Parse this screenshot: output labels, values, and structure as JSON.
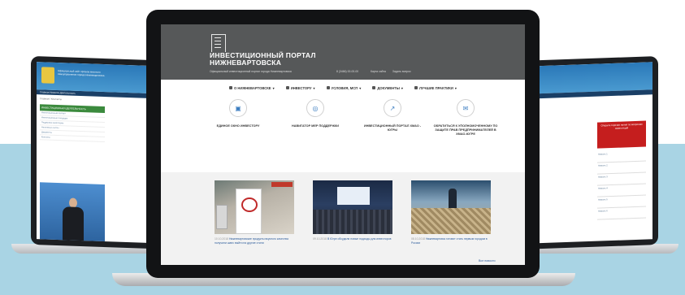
{
  "portal": {
    "title_line1": "ИНВЕСТИЦИОННЫЙ ПОРТАЛ",
    "title_line2": "НИЖНЕВАРТОВСКА",
    "subtitle": "Официальный инвестиционный портал города Нижневартовска",
    "phone": "8 (3466) 00-00-00",
    "links": [
      "Карта сайта",
      "Задать вопрос"
    ]
  },
  "nav": {
    "items": [
      "О НИЖНЕВАРТОВСКЕ",
      "ИНВЕСТОРУ",
      "УСЛОВИЯ, МСП",
      "ДОКУМЕНТЫ",
      "ЛУЧШИЕ ПРАКТИКИ"
    ]
  },
  "tiles": [
    {
      "label": "ЕДИНОЕ ОКНО ИНВЕСТОРУ",
      "icon": "calendar-icon"
    },
    {
      "label": "НАВИГАТОР МЕР ПОДДЕРЖКИ",
      "icon": "target-icon"
    },
    {
      "label": "ИНВЕСТИЦИОННЫЙ ПОРТАЛ ХМАО - ЮГРЫ",
      "icon": "chart-icon"
    },
    {
      "label": "ОБРАТИТЬСЯ К УПОЛНОМОЧЕННОМУ ПО ЗАЩИТЕ ПРАВ ПРЕДПРИНИМАТЕЛЕЙ В ХМАО-ЮГРЕ",
      "icon": "chat-icon"
    }
  ],
  "news": [
    {
      "date": "10.10.2018",
      "text": "Нижневартовские продукты вкусного качества получили шанс выйти на другие стили"
    },
    {
      "date": "09.10.2018",
      "text": "В Югре обсудили новые подходы для инвесторов"
    },
    {
      "date": "08.10.2018",
      "text": "Нижневартовск готовит стать первым городом в России"
    }
  ],
  "more_label": "Все новости",
  "left_site": {
    "title": "Официальный сайт органов местного самоуправления города Нижневартовска",
    "nav": "Главная Новости Деятельность",
    "breadcrumb": "Главная / Контакты",
    "side_heading": "ИНВЕСТИЦИОННАЯ ДЕЯТЕЛЬНОСТЬ",
    "side_items": [
      "Инвестиционный паспорт",
      "Инвестиционные площадки",
      "Поддержка инвесторов",
      "Налоговые льготы",
      "Документы",
      "Контакты"
    ]
  },
  "right_site": {
    "red_box": "Открыта горячая линия по вопросам инвестиций",
    "items": [
      "Новость 1",
      "Новость 2",
      "Новость 3",
      "Новость 4",
      "Новость 5",
      "Новость 6"
    ]
  },
  "colors": {
    "hero": "#565859",
    "band": "#a9d4e4",
    "link": "#2a5a9a"
  }
}
